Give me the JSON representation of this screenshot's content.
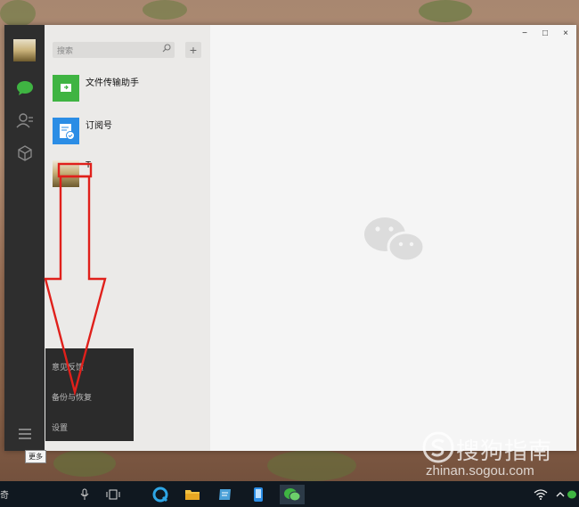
{
  "sidebar": {
    "icons": [
      "avatar",
      "chat-icon",
      "contacts-icon",
      "cube-icon",
      "more-menu-icon"
    ],
    "more_tooltip": "更多"
  },
  "chat_list": {
    "search_placeholder": "搜索",
    "add_label": "+",
    "items": [
      {
        "name": "文件传输助手",
        "icon": "file-transfer-icon",
        "color": "#3fb442"
      },
      {
        "name": "订阅号",
        "icon": "subscription-icon",
        "color": "#2b8de5"
      },
      {
        "name": "T",
        "icon": "avatar-photo"
      }
    ]
  },
  "window_controls": {
    "minimize": "−",
    "maximize": "□",
    "close": "×"
  },
  "more_menu": {
    "items": [
      "意见反馈",
      "备份与恢复",
      "设置"
    ]
  },
  "watermark": {
    "brand": "搜狗指南",
    "url": "zhinan.sogou.com"
  },
  "taskbar": {
    "items": [
      "search-mic-icon",
      "task-view-icon",
      "browser-icon",
      "file-explorer-icon",
      "notes-icon",
      "phone-icon",
      "wechat-icon",
      "wifi-icon",
      "chevron-up-icon"
    ],
    "left_text": "奇"
  },
  "colors": {
    "accent_red": "#e0201b",
    "wechat_green": "#3fb442"
  }
}
